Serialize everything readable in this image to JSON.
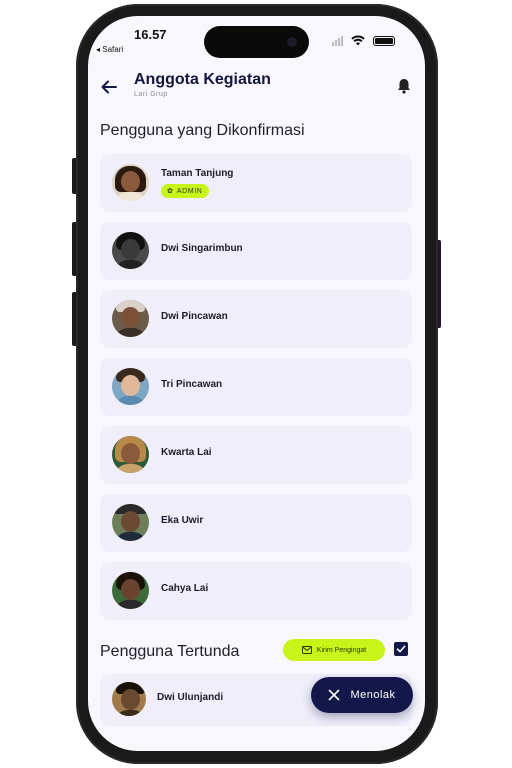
{
  "status_bar": {
    "time": "16.57",
    "back_app": "◂ Safari"
  },
  "header": {
    "title": "Anggota Kegiatan",
    "subtitle": "Lari Grup"
  },
  "confirmed": {
    "title": "Pengguna yang Dikonfirmasi",
    "admin_label": "ADMIN",
    "members": [
      {
        "name": "Taman Tanjung",
        "role": "ADMIN"
      },
      {
        "name": "Dwi Singarimbun"
      },
      {
        "name": "Dwi Pincawan"
      },
      {
        "name": "Tri Pincawan"
      },
      {
        "name": "Kwarta Lai"
      },
      {
        "name": "Eka Uwir"
      },
      {
        "name": "Cahya Lai"
      }
    ]
  },
  "pending": {
    "title": "Pengguna Tertunda",
    "remind_label": "Kirim Pengingat",
    "checkbox_checked": true,
    "members": [
      {
        "name": "Dwi Ulunjandi"
      }
    ]
  },
  "reject_button": {
    "label": "Menolak"
  },
  "colors": {
    "accent_lime": "#c9f41a",
    "navy": "#14174a",
    "card": "#efeef9",
    "screen": "#f8f7fd"
  },
  "icons": [
    "back-arrow-icon",
    "bell-icon",
    "gear-icon",
    "mail-icon",
    "check-icon",
    "close-icon",
    "wifi-icon",
    "battery-icon"
  ]
}
